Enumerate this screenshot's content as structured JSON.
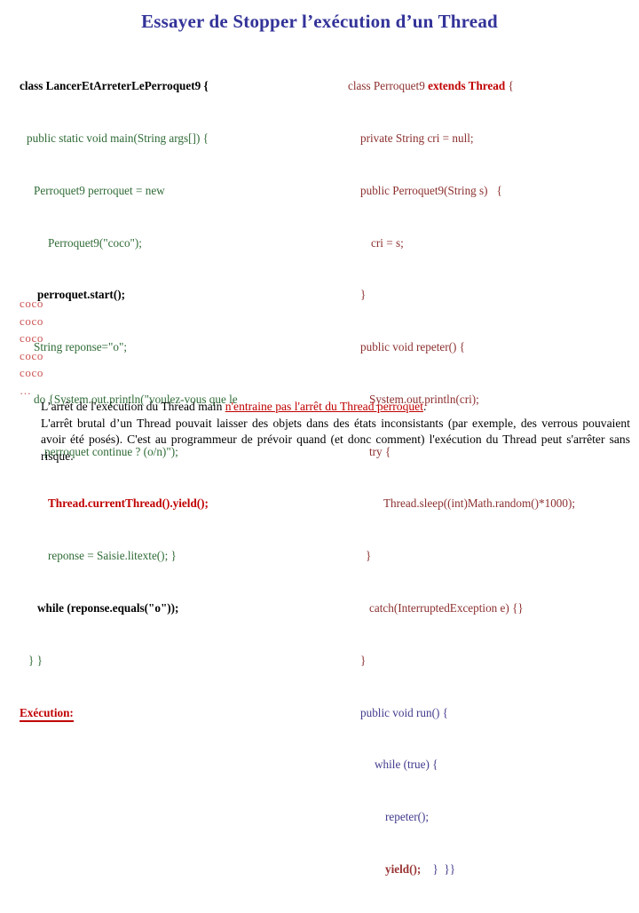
{
  "title": "Essayer de Stopper l’exécution d’un Thread",
  "left_code": {
    "lines": [
      {
        "indent": 0,
        "text": "class LancerEtArreterLePerroquet9 {",
        "style": "black-bold"
      },
      {
        "indent": 8,
        "text": "public static void main(String args[]) {",
        "style": "green"
      },
      {
        "indent": 16,
        "text": "Perroquet9 perroquet = new",
        "style": "green"
      },
      {
        "indent": 32,
        "text": "Perroquet9(\"coco\");",
        "style": "green"
      },
      {
        "indent": 20,
        "text": "perroquet.start();",
        "style": "black-bold"
      },
      {
        "indent": 16,
        "text": "String reponse=\"o\";",
        "style": "green"
      },
      {
        "indent": 16,
        "text": "do {System.out.println(\"voulez-vous que le",
        "style": "green"
      },
      {
        "indent": 28,
        "text": "perroquet continue ? (o/n)\");",
        "style": "green"
      },
      {
        "indent": 32,
        "text": "Thread.currentThread().yield();",
        "style": "red-bold"
      },
      {
        "indent": 32,
        "text": "reponse = Saisie.litexte(); }",
        "style": "green"
      },
      {
        "indent": 20,
        "text": "while (reponse.equals(\"o\"));",
        "style": "black-bold"
      },
      {
        "indent": 10,
        "text": "} }",
        "style": "green"
      }
    ],
    "execution_label": "Exécution:",
    "output_lines": [
      "coco",
      "coco",
      "coco",
      "coco",
      "coco"
    ],
    "output_ellipsis": "…"
  },
  "right_code": {
    "lines": [
      {
        "indent": 0,
        "pre": "class Perroquet9 ",
        "kw": "extends Thread",
        "post": " {",
        "style": "maroon",
        "kw_style": "red-bold"
      },
      {
        "indent": 14,
        "text": "private String cri = null;",
        "style": "maroon"
      },
      {
        "indent": 14,
        "text": "public Perroquet9(String s)   {",
        "style": "maroon"
      },
      {
        "indent": 26,
        "text": "cri = s;",
        "style": "maroon"
      },
      {
        "indent": 14,
        "text": "}",
        "style": "maroon"
      },
      {
        "indent": 14,
        "text": "public void repeter() {",
        "style": "maroon"
      },
      {
        "indent": 24,
        "text": "System.out.println(cri);",
        "style": "maroon"
      },
      {
        "indent": 24,
        "text": "try {",
        "style": "maroon"
      },
      {
        "indent": 40,
        "text": "Thread.sleep((int)Math.random()*1000);",
        "style": "maroon"
      },
      {
        "indent": 20,
        "text": "}",
        "style": "maroon"
      },
      {
        "indent": 24,
        "text": "catch(InterruptedException e) {}",
        "style": "maroon"
      },
      {
        "indent": 14,
        "text": "}",
        "style": "maroon"
      },
      {
        "indent": 14,
        "text": "public void run() {",
        "style": "purple"
      },
      {
        "indent": 30,
        "text": "while (true) {",
        "style": "purple"
      },
      {
        "indent": 42,
        "text": "repeter();",
        "style": "purple"
      },
      {
        "indent": 42,
        "pre": "",
        "kw": "yield();",
        "post": "    }  }}",
        "style": "purple",
        "kw_style": "darkred-bold"
      }
    ]
  },
  "bottom": {
    "para1_before": "L’arrêt de l'exécution du Thread main ",
    "para1_highlight": "n'entraine pas l'arrêt du Thread perroquet",
    "para1_after": ".",
    "para2": "L'arrêt brutal d’un Thread pouvait laisser des objets dans des états inconsistants (par exemple, des verrous pouvaient avoir été posés). C'est au programmeur de prévoir quand (et donc comment) l'exécution du Thread peut s'arrêter sans risque."
  },
  "colors": {
    "title": "#333399",
    "green": "#2f6b36",
    "red": "#c00000",
    "maroon": "#8c2f2f",
    "purple": "#403a8c",
    "coco": "#cc5555"
  }
}
